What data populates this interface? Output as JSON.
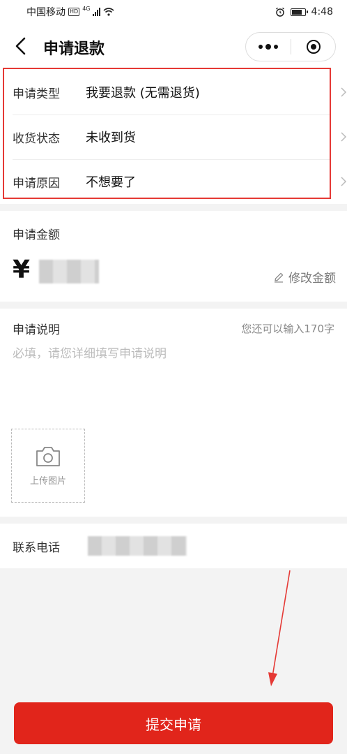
{
  "statusbar": {
    "carrier": "中国移动",
    "hd": "HD",
    "network": "4G",
    "time": "4:48"
  },
  "navbar": {
    "title": "申请退款"
  },
  "refund_info": {
    "rows": [
      {
        "label": "申请类型",
        "value": "我要退款 (无需退货)"
      },
      {
        "label": "收货状态",
        "value": "未收到货"
      },
      {
        "label": "申请原因",
        "value": "不想要了"
      }
    ]
  },
  "amount": {
    "label": "申请金额",
    "currency": "¥",
    "edit_label": "修改金额"
  },
  "description": {
    "label": "申请说明",
    "counter": "您还可以输入170字",
    "placeholder": "必填，请您详细填写申请说明",
    "upload_label": "上传图片"
  },
  "contact": {
    "label": "联系电话"
  },
  "submit": {
    "label": "提交申请"
  },
  "colors": {
    "accent": "#e1251b",
    "annotation": "#e53935"
  }
}
